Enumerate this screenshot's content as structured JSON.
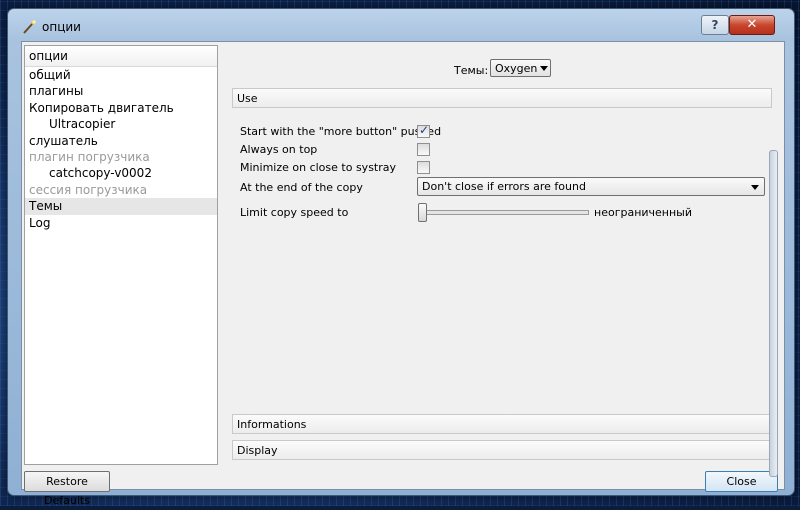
{
  "window": {
    "title": "опции",
    "help_label": "?",
    "close_label": "✕"
  },
  "sidebar": {
    "header": "опции",
    "items": [
      {
        "label": "общий",
        "indent": false,
        "disabled": false,
        "selected": false
      },
      {
        "label": "плагины",
        "indent": false,
        "disabled": false,
        "selected": false
      },
      {
        "label": "Копировать двигатель",
        "indent": false,
        "disabled": false,
        "selected": false
      },
      {
        "label": "Ultracopier",
        "indent": true,
        "disabled": false,
        "selected": false
      },
      {
        "label": "слушатель",
        "indent": false,
        "disabled": false,
        "selected": false
      },
      {
        "label": "плагин погрузчика",
        "indent": false,
        "disabled": true,
        "selected": false
      },
      {
        "label": "catchcopy-v0002",
        "indent": true,
        "disabled": false,
        "selected": false
      },
      {
        "label": "сессия погрузчика",
        "indent": false,
        "disabled": true,
        "selected": false
      },
      {
        "label": "Темы",
        "indent": false,
        "disabled": false,
        "selected": true
      },
      {
        "label": "Log",
        "indent": false,
        "disabled": false,
        "selected": false
      }
    ]
  },
  "panel": {
    "themes_label": "Темы:",
    "themes_value": "Oxygen",
    "sections": {
      "use": "Use",
      "informations": "Informations",
      "display": "Display"
    },
    "options": {
      "more_button_label": "Start with the \"more button\" pushed",
      "more_button_checked": true,
      "always_on_top_label": "Always on top",
      "always_on_top_checked": false,
      "minimize_label": "Minimize on close to systray",
      "minimize_checked": false,
      "end_of_copy_label": "At the end of the copy",
      "end_of_copy_value": "Don't close if errors are found",
      "limit_speed_label": "Limit copy speed to",
      "limit_speed_value": "неограниченный",
      "limit_speed_level": 0
    }
  },
  "buttons": {
    "restore_defaults": "Restore Defaults",
    "close": "Close"
  }
}
